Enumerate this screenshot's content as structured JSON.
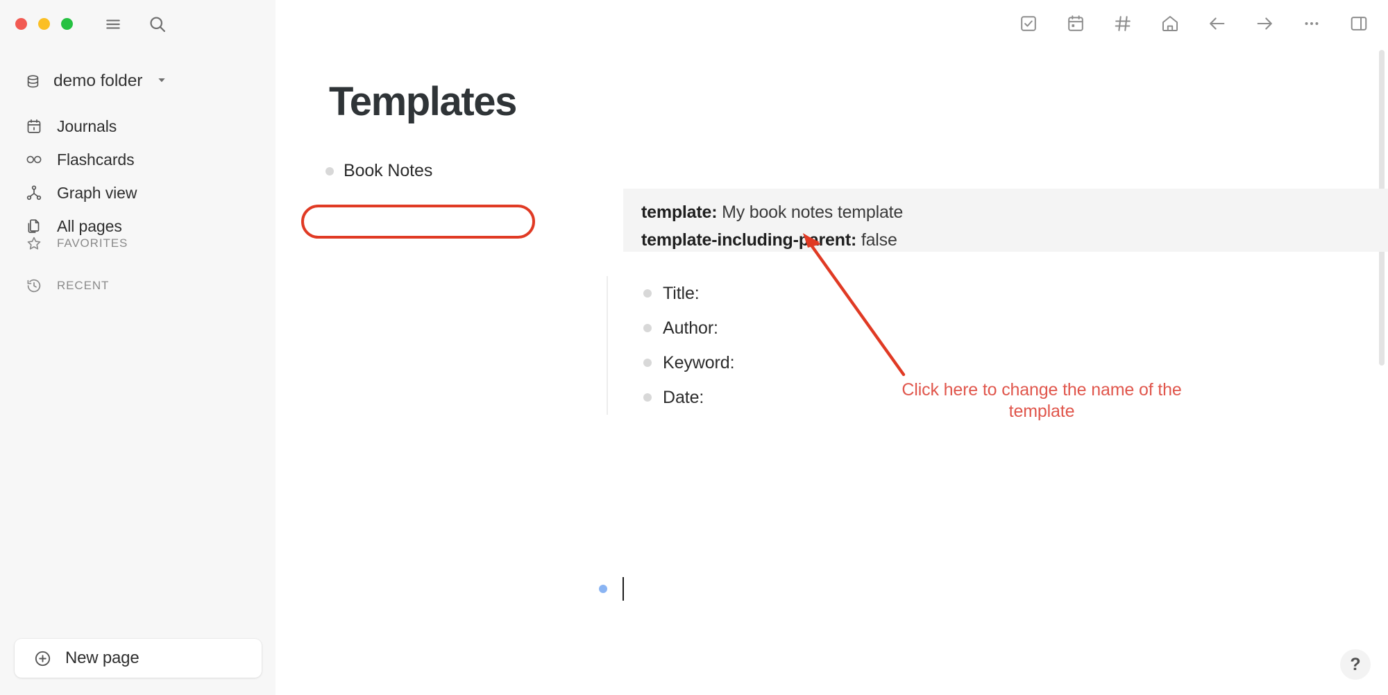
{
  "window": {
    "traffic_lights": [
      {
        "name": "close",
        "color": "#f25a52"
      },
      {
        "name": "minimize",
        "color": "#fbbf24"
      },
      {
        "name": "maximize",
        "color": "#25c141"
      }
    ]
  },
  "sidebar": {
    "top_icons": [
      {
        "name": "menu-icon",
        "label": "Menu"
      },
      {
        "name": "search-icon",
        "label": "Search"
      }
    ],
    "folder": {
      "label": "demo folder",
      "icon": "database-icon",
      "caret": "chevron-down-icon"
    },
    "nav_items": [
      {
        "label": "Journals",
        "icon": "calendar-icon"
      },
      {
        "label": "Flashcards",
        "icon": "infinity-icon"
      },
      {
        "label": "Graph view",
        "icon": "graph-icon"
      },
      {
        "label": "All pages",
        "icon": "pages-icon"
      }
    ],
    "sections": [
      {
        "label": "FAVORITES",
        "icon": "star-icon"
      },
      {
        "label": "RECENT",
        "icon": "history-icon"
      }
    ],
    "new_page": {
      "label": "New page",
      "icon": "plus-circle-icon"
    }
  },
  "toolbar": {
    "icons": [
      {
        "name": "checkbox-icon",
        "label": "Todos"
      },
      {
        "name": "calendar-icon",
        "label": "Journals"
      },
      {
        "name": "hash-icon",
        "label": "Tags"
      },
      {
        "name": "home-icon",
        "label": "Home"
      },
      {
        "name": "arrow-left-icon",
        "label": "Back"
      },
      {
        "name": "arrow-right-icon",
        "label": "Forward"
      },
      {
        "name": "dots-icon",
        "label": "More"
      },
      {
        "name": "sidebar-icon",
        "label": "Right sidebar"
      }
    ]
  },
  "page": {
    "title": "Templates",
    "root_block": "Book Notes",
    "properties": [
      {
        "key": "template",
        "sep": ": ",
        "value": "My book notes template",
        "highlighted": true
      },
      {
        "key": "template-including-parent",
        "sep": ": ",
        "value": "false",
        "highlighted": false
      }
    ],
    "children": [
      {
        "text": "Title:"
      },
      {
        "text": "Author:"
      },
      {
        "text": "Keyword:"
      },
      {
        "text": "Date:"
      }
    ],
    "empty_block": {
      "text": ""
    }
  },
  "annotation": {
    "text": "Click here to change the name of the template",
    "highlight_color": "#e03a24",
    "text_color": "#e0564c",
    "shape": "rounded-rect-around-template-property",
    "arrow": "arrow-pointing-to-template-property"
  },
  "help": {
    "label": "?"
  },
  "colors": {
    "sidebar_bg": "#f7f7f7",
    "main_bg": "#ffffff",
    "property_block_bg": "#f4f4f4",
    "bullet": "#d8d8d8",
    "bullet_active": "#8ab4f3",
    "text": "#2b2b2b",
    "muted_text": "#8a8a8a",
    "scrollbar": "#e3e3e3"
  }
}
